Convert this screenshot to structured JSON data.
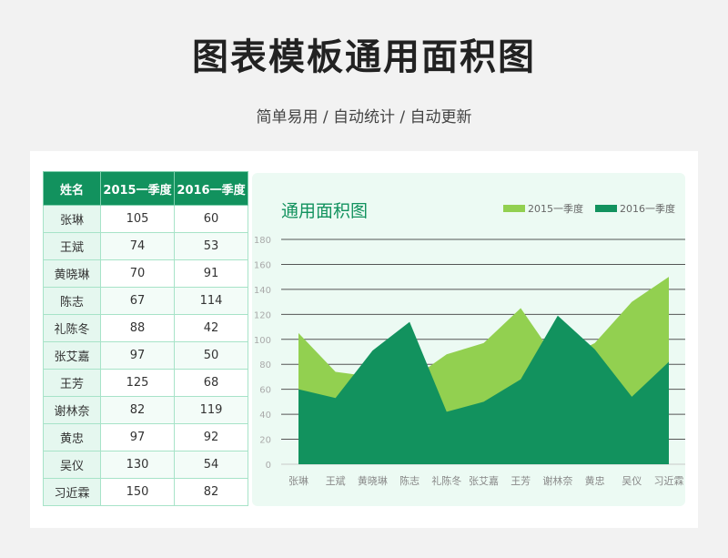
{
  "page": {
    "title": "图表模板通用面积图",
    "subtitle": "简单易用 / 自动统计 / 自动更新"
  },
  "table": {
    "headers": [
      "姓名",
      "2015一季度",
      "2016一季度"
    ],
    "rows": [
      [
        "张琳",
        "105",
        "60"
      ],
      [
        "王斌",
        "74",
        "53"
      ],
      [
        "黄晓琳",
        "70",
        "91"
      ],
      [
        "陈志",
        "67",
        "114"
      ],
      [
        "礼陈冬",
        "88",
        "42"
      ],
      [
        "张艾嘉",
        "97",
        "50"
      ],
      [
        "王芳",
        "125",
        "68"
      ],
      [
        "谢林奈",
        "82",
        "119"
      ],
      [
        "黄忠",
        "97",
        "92"
      ],
      [
        "吴仪",
        "130",
        "54"
      ],
      [
        "习近霖",
        "150",
        "82"
      ]
    ]
  },
  "colors": {
    "header_bg": "#12925e",
    "series_2015": "#92d050",
    "series_2016": "#12925e",
    "chart_title": "#12925e"
  },
  "chart_data": {
    "type": "area",
    "title": "通用面积图",
    "xlabel": "",
    "ylabel": "",
    "categories": [
      "张琳",
      "王斌",
      "黄晓琳",
      "陈志",
      "礼陈冬",
      "张艾嘉",
      "王芳",
      "谢林奈",
      "黄忠",
      "吴仪",
      "习近霖"
    ],
    "series": [
      {
        "name": "2015一季度",
        "values": [
          105,
          74,
          70,
          67,
          88,
          97,
          125,
          82,
          97,
          130,
          150
        ]
      },
      {
        "name": "2016一季度",
        "values": [
          60,
          53,
          91,
          114,
          42,
          50,
          68,
          119,
          92,
          54,
          82
        ]
      }
    ],
    "ylim": [
      0,
      180
    ],
    "yticks": [
      0,
      20,
      40,
      60,
      80,
      100,
      120,
      140,
      160,
      180
    ],
    "grid": true,
    "legend": "top-right"
  }
}
